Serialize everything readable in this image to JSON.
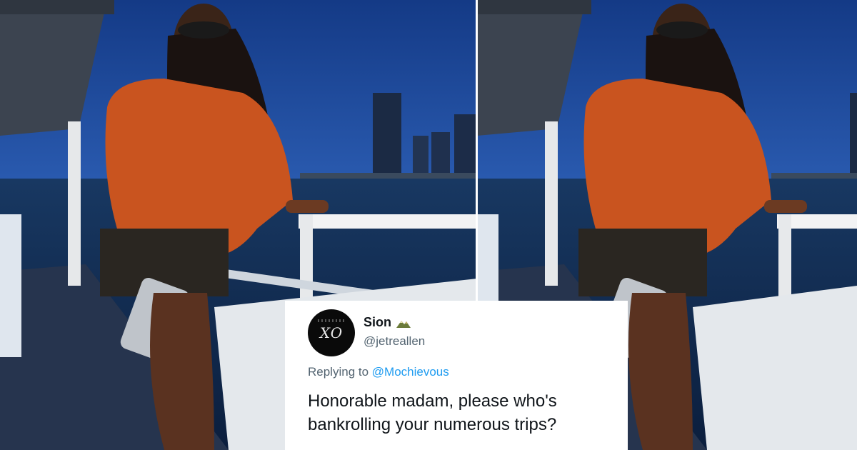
{
  "photos": [
    {
      "name": "photo-left",
      "description_icon": "woman-on-boat-photo"
    },
    {
      "name": "photo-right",
      "description_icon": "woman-on-boat-photo"
    }
  ],
  "tweet": {
    "avatar_text": "XO",
    "display_name": "Sion",
    "badge_icon": "mountain-icon",
    "handle": "@jetreallen",
    "replying_label": "Replying to",
    "replying_to": "@Mochievous",
    "body": "Honorable madam, please who's bankrolling your numerous trips?"
  },
  "colors": {
    "sky": "#1b3f86",
    "water": "#102a52",
    "jacket": "#c9541f",
    "link": "#1d9bf0",
    "handle_gray": "#536471"
  }
}
